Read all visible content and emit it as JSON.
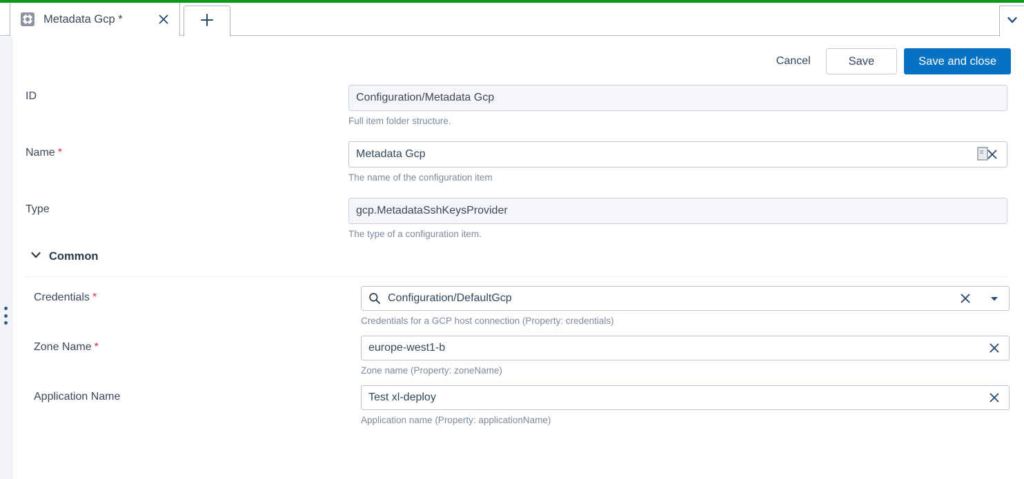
{
  "window": {
    "accent_color": "#0e9a17",
    "primary_color": "#0672c4",
    "required_color": "#e3264c"
  },
  "tabs": {
    "active": {
      "icon": "gear-icon",
      "title": "Metadata Gcp *",
      "close_icon": "close-icon"
    },
    "add_tab_icon": "plus-icon",
    "overflow_icon": "chevron-down-icon"
  },
  "toolbar": {
    "cancel_label": "Cancel",
    "save_label": "Save",
    "save_and_close_label": "Save and close"
  },
  "form": {
    "fields": [
      {
        "label": "ID",
        "required": false,
        "value": "Configuration/Metadata Gcp",
        "placeholder": "",
        "hint": "Full item folder structure.",
        "readonly": true
      },
      {
        "label": "Name",
        "required": true,
        "value": "Metadata Gcp",
        "placeholder": "",
        "hint": "The name of the configuration item",
        "readonly": false
      },
      {
        "label": "Type",
        "required": false,
        "value": "gcp.MetadataSshKeysProvider",
        "placeholder": "",
        "hint": "The type of a configuration item.",
        "readonly": true
      }
    ],
    "section": {
      "title": "Common",
      "collapse_icon": "chevron-down-icon",
      "expanded": true,
      "fields": [
        {
          "label": "Credentials",
          "required": true,
          "value": "Configuration/DefaultGcp",
          "placeholder": "",
          "hint": "Credentials for a GCP host connection (Property: credentials)",
          "lead_icon": "search-icon",
          "clear_icon": "clear-icon",
          "dropdown_icon": "caret-down-icon",
          "readonly": false
        },
        {
          "label": "Zone Name",
          "required": true,
          "value": "europe-west1-b",
          "placeholder": "",
          "hint": "Zone name (Property: zoneName)",
          "clear_icon": "clear-icon",
          "readonly": false
        },
        {
          "label": "Application Name",
          "required": false,
          "value": "Test xl-deploy",
          "placeholder": "",
          "hint": "Application name (Property: applicationName)",
          "clear_icon": "clear-icon",
          "readonly": false
        }
      ]
    }
  },
  "rail": {
    "handle_icon": "drag-handle-icon"
  }
}
